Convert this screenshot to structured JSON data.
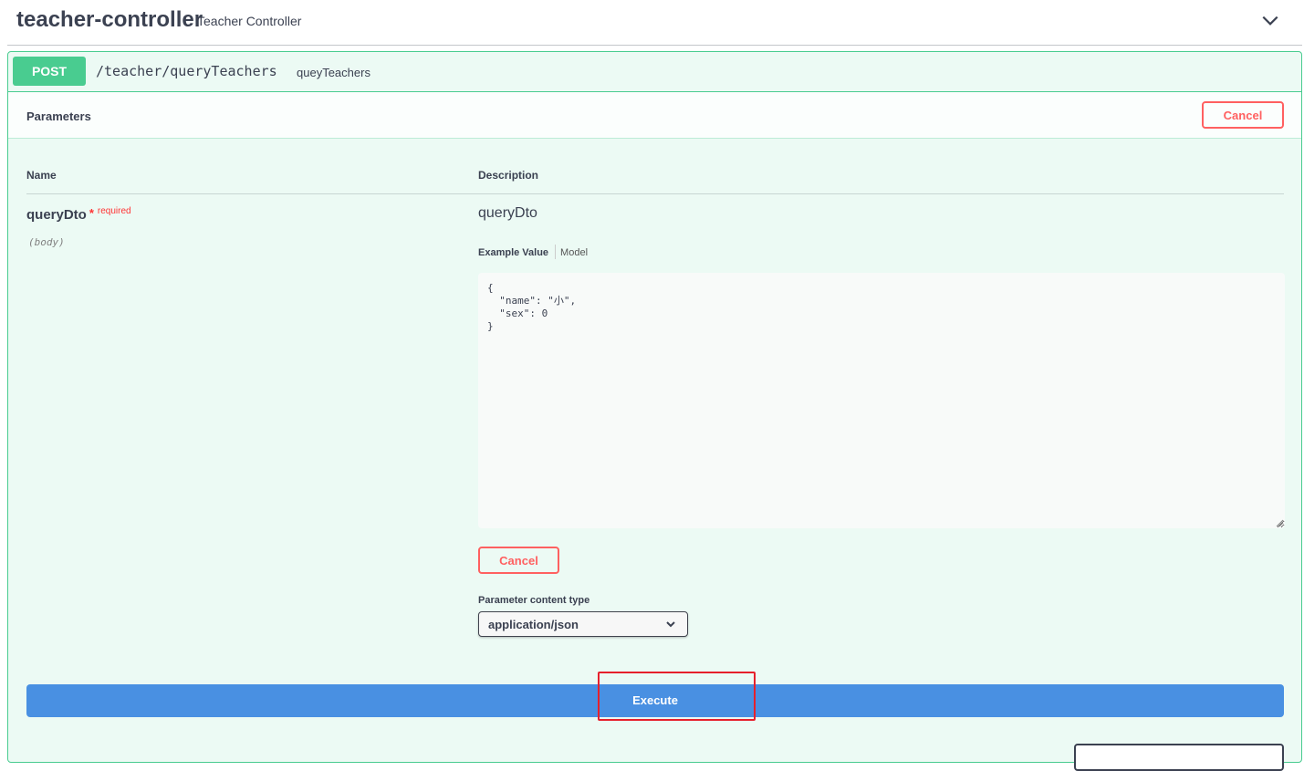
{
  "tag": {
    "name": "teacher-controller",
    "description": "Teacher Controller",
    "toggle_icon": "chevron-down-icon"
  },
  "operation": {
    "method": "POST",
    "path": "/teacher/queryTeachers",
    "summary": "queyTeachers",
    "method_color": "#49cc90"
  },
  "parameters": {
    "title": "Parameters",
    "cancel_label": "Cancel",
    "columns": {
      "name": "Name",
      "description": "Description"
    },
    "items": [
      {
        "name": "queryDto",
        "required_star": "*",
        "required_label": "required",
        "in": "(body)",
        "description": "queryDto",
        "tabs": {
          "example": "Example Value",
          "model": "Model"
        },
        "body_value": "{\n  \"name\": \"小\",\n  \"sex\": 0\n}"
      }
    ],
    "inline_cancel_label": "Cancel",
    "content_type_label": "Parameter content type",
    "content_type_value": "application/json"
  },
  "execute": {
    "label": "Execute",
    "color": "#4990e2",
    "highlight_color": "#e6202c"
  }
}
